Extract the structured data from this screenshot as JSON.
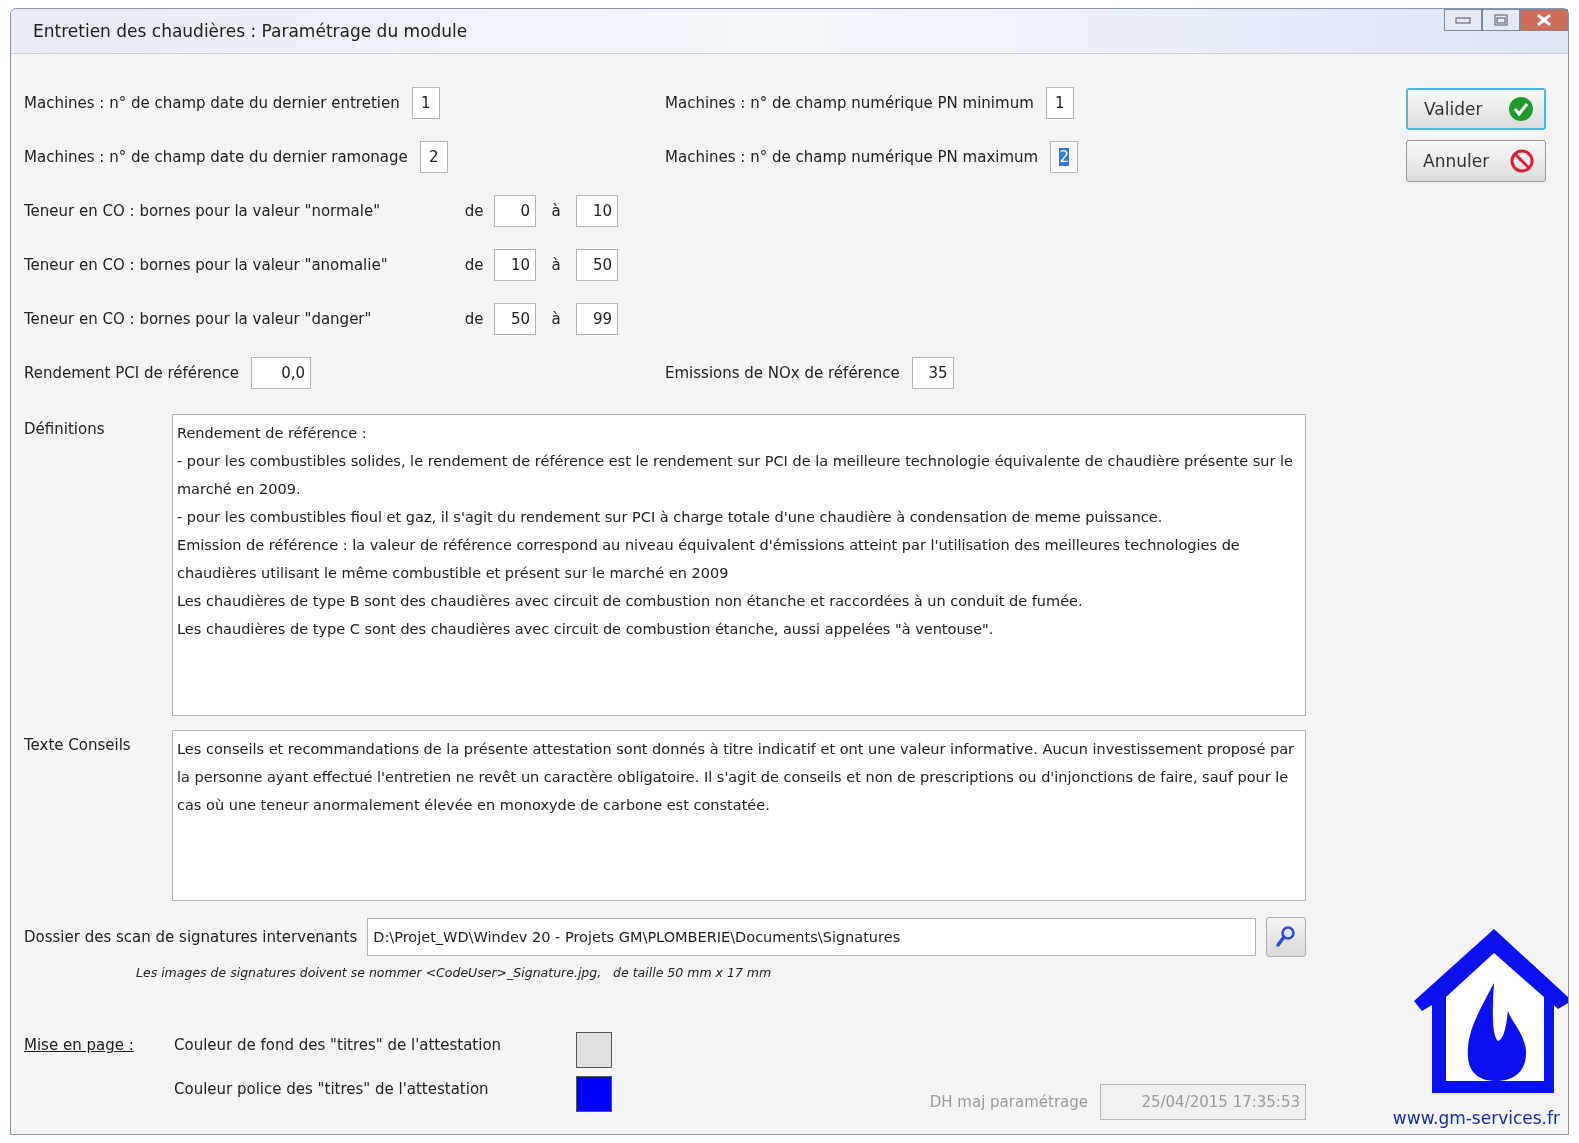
{
  "window": {
    "title": "Entretien des chaudières : Paramétrage du module"
  },
  "top_fields": [
    {
      "label": "Machines : n° de champ date du dernier entretien",
      "value": "1",
      "highlighted": false
    },
    {
      "label": "Machines : n° de champ numérique PN minimum",
      "value": "1",
      "highlighted": false
    },
    {
      "label": "Machines : n° de champ date du dernier ramonage",
      "value": "2",
      "highlighted": false
    },
    {
      "label": "Machines : n° de champ numérique PN maximum",
      "value": "2",
      "highlighted": true
    }
  ],
  "co_bounds": [
    {
      "label": "Teneur en CO : bornes pour la valeur \"normale\"",
      "de": "de",
      "from": "0",
      "a": "à",
      "to": "10"
    },
    {
      "label": "Teneur en CO : bornes pour la valeur \"anomalie\"",
      "de": "de",
      "from": "10",
      "a": "à",
      "to": "50"
    },
    {
      "label": "Teneur en CO : bornes pour la valeur \"danger\"",
      "de": "de",
      "from": "50",
      "a": "à",
      "to": "99"
    }
  ],
  "rendement": {
    "label": "Rendement PCI de référence",
    "value": "0,0"
  },
  "emissions": {
    "label": "Emissions de NOx de référence",
    "value": "35"
  },
  "definitions": {
    "label": "Définitions",
    "lines": [
      "Rendement de référence :",
      "- pour les combustibles solides, le rendement de référence est le rendement sur PCI de la meilleure technologie équivalente de chaudière présente sur le marché en 2009.",
      "- pour les combustibles fioul et gaz, il s'agit du rendement sur PCI à charge totale d'une chaudière à condensation de meme puissance.",
      "Emission de référence : la valeur de référence correspond au niveau équivalent d'émissions atteint par l'utilisation des meilleures technologies de chaudières utilisant le même combustible et présent sur le marché en 2009",
      "Les chaudières de type B sont des chaudières avec circuit de combustion non étanche et raccordées à un conduit de fumée.",
      "Les chaudières de type C sont des chaudières avec circuit de combustion étanche, aussi appelées \"à ventouse\"."
    ]
  },
  "conseils": {
    "label": "Texte Conseils",
    "text": "Les conseils et recommandations de la présente attestation sont donnés à titre indicatif et ont une valeur informative. Aucun investissement proposé par la personne ayant effectué l'entretien ne revêt un caractère obligatoire. Il s'agit de conseils et non de prescriptions ou d'injonctions de faire, sauf pour le cas où une teneur anormalement élevée en monoxyde de carbone est constatée."
  },
  "dossier": {
    "label": "Dossier des scan de signatures intervenants",
    "value": "D:\\Projet_WD\\Windev 20 - Projets GM\\PLOMBERIE\\Documents\\Signatures",
    "hint": "Les images de signatures doivent se nommer <CodeUser>_Signature.jpg,   de taille 50 mm x 17 mm"
  },
  "mise_en_page": {
    "label": "Mise en page :",
    "rows": [
      {
        "label": "Couleur de fond des \"titres\" de l'attestation",
        "color": "#e0e0e0"
      },
      {
        "label": "Couleur police des \"titres\" de l'attestation",
        "color": "#0000ff"
      }
    ]
  },
  "dh": {
    "label": "DH maj paramétrage",
    "value": "25/04/2015 17:35:53",
    "disabled": true
  },
  "buttons": [
    {
      "label": "Valider",
      "kind": "ok"
    },
    {
      "label": "Annuler",
      "kind": "cancel"
    }
  ],
  "website": "www.gm-services.fr"
}
